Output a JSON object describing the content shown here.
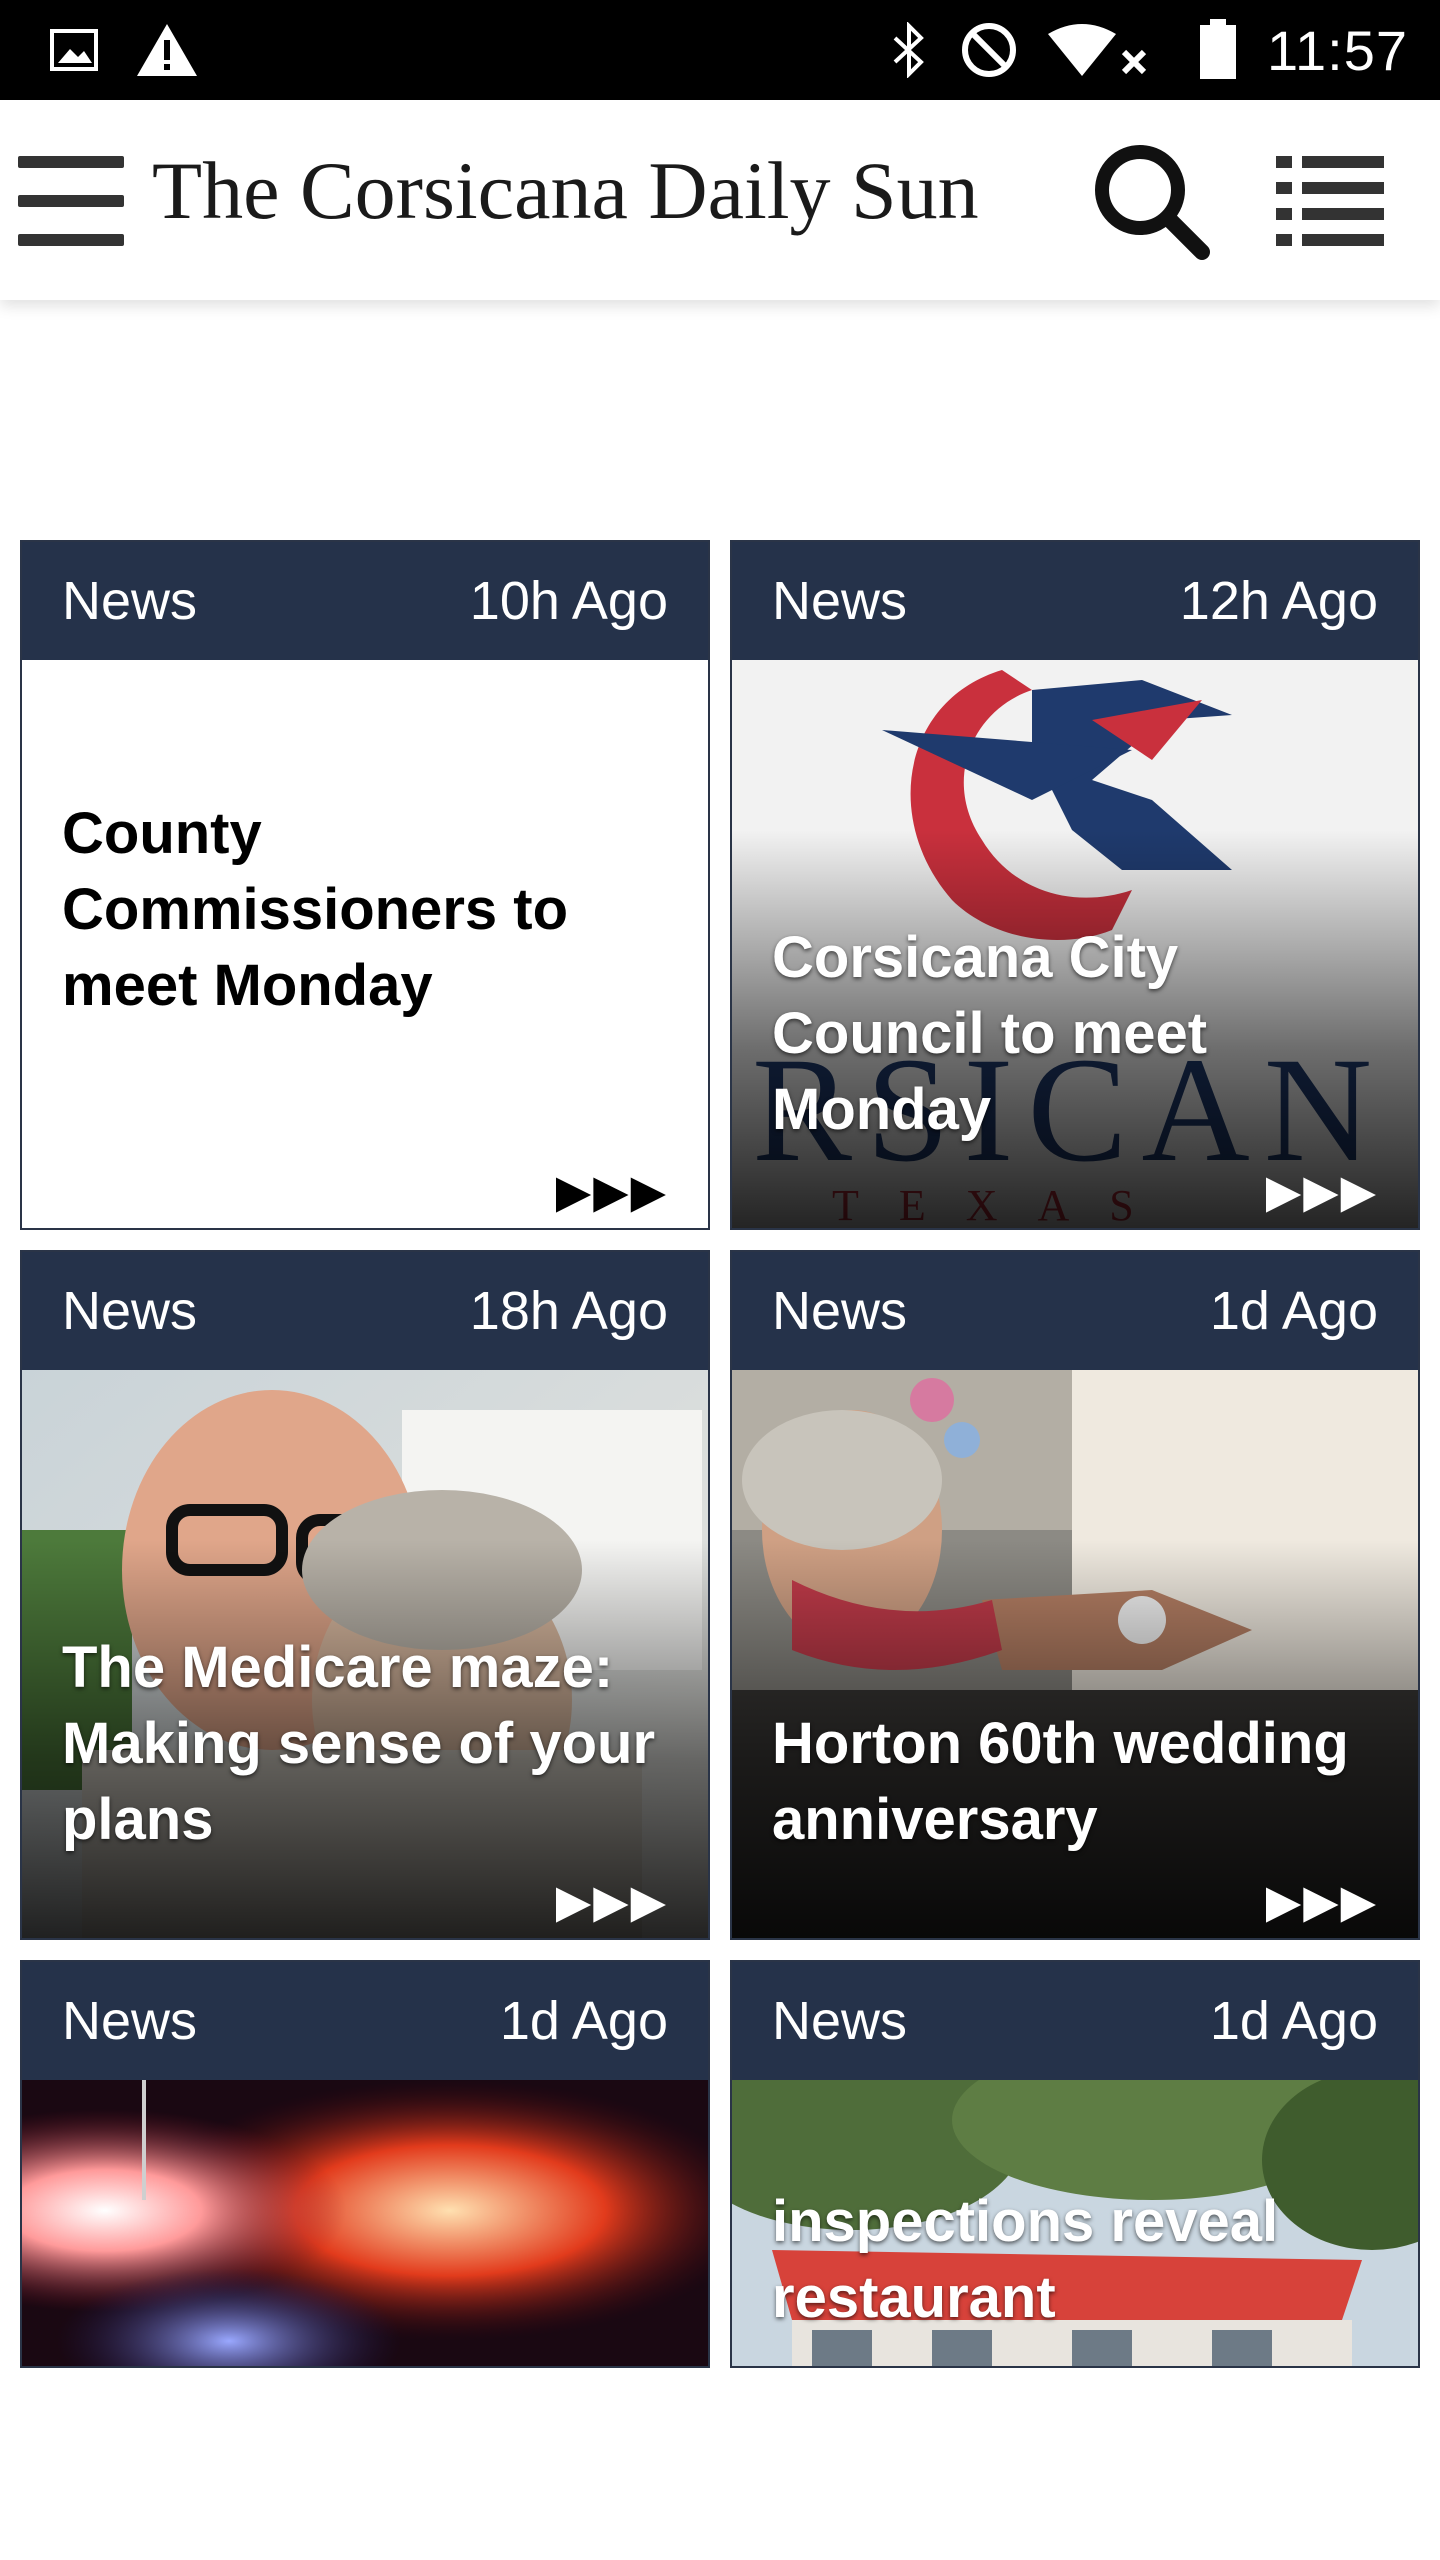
{
  "status_bar": {
    "time": "11:57",
    "icons": [
      "image-icon",
      "warning-icon",
      "bluetooth-icon",
      "do-not-disturb-icon",
      "wifi-icon",
      "battery-icon"
    ]
  },
  "app_bar": {
    "title": "The Corsicana Daily Sun",
    "icons": [
      "hamburger-menu-icon",
      "search-icon",
      "list-view-icon"
    ]
  },
  "more_label": "▶▶▶",
  "cards": [
    {
      "category": "News",
      "age": "10h Ago",
      "headline": "County Commissioners to meet Monday",
      "image": "none"
    },
    {
      "category": "News",
      "age": "12h Ago",
      "headline": "Corsicana City Council to meet Monday",
      "image": "corsicana-logo"
    },
    {
      "category": "News",
      "age": "18h Ago",
      "headline": "The Medicare maze: Making sense of your plans",
      "image": "older-couple"
    },
    {
      "category": "News",
      "age": "1d Ago",
      "headline": "Horton 60th wedding anniversary",
      "image": "couple-dancing"
    },
    {
      "category": "News",
      "age": "1d Ago",
      "headline": "",
      "image": "police-lights"
    },
    {
      "category": "News",
      "age": "1d Ago",
      "headline": "inspections reveal restaurant",
      "image": "store-front"
    }
  ],
  "colors": {
    "card_header": "#25324a",
    "status_bar": "#000000",
    "app_bar": "#ffffff"
  }
}
